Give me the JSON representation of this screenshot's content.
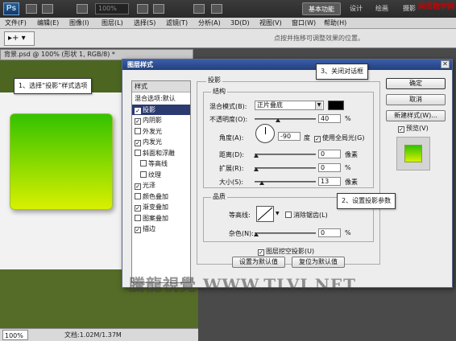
{
  "app": {
    "logo": "Ps",
    "zoom_combo": "100%",
    "workspaces": [
      "基本功能",
      "设计",
      "绘画",
      "摄影"
    ]
  },
  "menu": [
    "文件(F)",
    "编辑(E)",
    "图像(I)",
    "图层(L)",
    "选择(S)",
    "滤镜(T)",
    "分析(A)",
    "3D(D)",
    "视图(V)",
    "窗口(W)",
    "帮助(H)"
  ],
  "options_bar": {
    "tool_preset": "▸+ ▾",
    "hint": "点按并拖移可调整效果的位置。"
  },
  "document": {
    "tab_title": "背景.psd @ 100% (形状 1, RGB/8) *",
    "zoom": "100%",
    "info": "文档:1.02M/1.37M"
  },
  "dialog": {
    "title": "图层样式",
    "styles_header": "样式",
    "styles": [
      {
        "label": "混合选项:默认",
        "checkbox": false,
        "checked": false,
        "selected": false,
        "indent": false
      },
      {
        "label": "投影",
        "checkbox": true,
        "checked": true,
        "selected": true,
        "indent": false
      },
      {
        "label": "内阴影",
        "checkbox": true,
        "checked": true,
        "selected": false,
        "indent": false
      },
      {
        "label": "外发光",
        "checkbox": true,
        "checked": false,
        "selected": false,
        "indent": false
      },
      {
        "label": "内发光",
        "checkbox": true,
        "checked": true,
        "selected": false,
        "indent": false
      },
      {
        "label": "斜面和浮雕",
        "checkbox": true,
        "checked": false,
        "selected": false,
        "indent": false
      },
      {
        "label": "等高线",
        "checkbox": true,
        "checked": false,
        "selected": false,
        "indent": true
      },
      {
        "label": "纹理",
        "checkbox": true,
        "checked": false,
        "selected": false,
        "indent": true
      },
      {
        "label": "光泽",
        "checkbox": true,
        "checked": true,
        "selected": false,
        "indent": false
      },
      {
        "label": "颜色叠加",
        "checkbox": true,
        "checked": false,
        "selected": false,
        "indent": false
      },
      {
        "label": "渐变叠加",
        "checkbox": true,
        "checked": true,
        "selected": false,
        "indent": false
      },
      {
        "label": "图案叠加",
        "checkbox": true,
        "checked": false,
        "selected": false,
        "indent": false
      },
      {
        "label": "描边",
        "checkbox": true,
        "checked": true,
        "selected": false,
        "indent": false
      }
    ],
    "section_title": "投影",
    "structure_title": "结构",
    "blend_mode_label": "混合模式(B):",
    "blend_mode_value": "正片叠底",
    "opacity_label": "不透明度(O):",
    "opacity_value": "40",
    "angle_label": "角度(A):",
    "angle_value": "-90",
    "angle_unit": "度",
    "global_light_label": "使用全局光(G)",
    "distance_label": "距离(D):",
    "distance_value": "0",
    "spread_label": "扩展(R):",
    "spread_value": "0",
    "size_label": "大小(S):",
    "size_value": "13",
    "px_unit": "像素",
    "pct_unit": "%",
    "quality_title": "品质",
    "contour_label": "等高线:",
    "anti_alias_label": "消除锯齿(L)",
    "noise_label": "杂色(N):",
    "noise_value": "0",
    "knockout_label": "图层挖空投影(U)",
    "make_default": "设置为默认值",
    "reset_default": "复位为默认值",
    "ok": "确定",
    "cancel": "取消",
    "new_style": "新建样式(W)...",
    "preview_label": "预览(V)",
    "shadow_color": "#000000"
  },
  "callouts": {
    "step1": "1、选择“投影”样式选项",
    "step2": "2、设置投影参数",
    "step3": "3、关闭对话框"
  },
  "watermarks": {
    "site_name": "网页教学网",
    "site_url": "www.webjx.com",
    "brand": "騰龍視覺 WWW.TLVI.NET"
  }
}
